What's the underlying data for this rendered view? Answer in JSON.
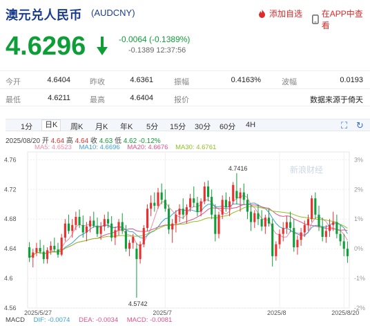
{
  "header": {
    "title": "澳元兑人民币",
    "code": "(AUDCNY)",
    "add_label": "添加自选",
    "app_label": "在APP中查看"
  },
  "quote": {
    "price": "4.6296",
    "change": "-0.0064",
    "change_pct": "(-0.1389%)",
    "sub_change": "-0.1389",
    "time": "12:37:56"
  },
  "stats": {
    "row1": [
      {
        "label": "今开",
        "value": "4.6404"
      },
      {
        "label": "昨收",
        "value": "4.6361"
      },
      {
        "label": "振幅",
        "value": "0.4163%"
      },
      {
        "label": "波幅",
        "value": "0.0193"
      }
    ],
    "row2": [
      {
        "label": "最低",
        "value": "4.6211"
      },
      {
        "label": "最高",
        "value": "4.6404"
      },
      {
        "label": "报价",
        "value": "数据来源于倚天"
      }
    ]
  },
  "tabs": [
    "1分",
    "日K",
    "周K",
    "月K",
    "年K",
    "5分",
    "15分",
    "30分",
    "60分",
    "4H"
  ],
  "active_tab": "日K",
  "info_line": {
    "date": "2025/08/20",
    "open_label": "开",
    "open": "4.64",
    "high_label": "高",
    "high": "4.64",
    "close_label": "收",
    "close": "4.63",
    "low_label": "低",
    "low": "4.62",
    "pct": "-0.12%"
  },
  "ma": [
    {
      "label": "MA5: 4.6523",
      "color": "#f08aa8"
    },
    {
      "label": "MA10: 4.6696",
      "color": "#3aa0d8"
    },
    {
      "label": "MA20: 4.6676",
      "color": "#e0508a"
    },
    {
      "label": "MA30: 4.6761",
      "color": "#8cc21e"
    }
  ],
  "macd": [
    {
      "label": "MACD",
      "color": "#444"
    },
    {
      "label": "DIF: -0.0074",
      "color": "#3aa0d8"
    },
    {
      "label": "DEA: -0.0034",
      "color": "#e0508a"
    },
    {
      "label": "MACD: -0.0081",
      "color": "#e0508a"
    }
  ],
  "colors": {
    "up": "#e8312f",
    "down": "#0e9e38",
    "brand": "#1a3c8e"
  },
  "chart_data": {
    "type": "candlestick",
    "y_ticks": [
      "4.76",
      "4.72",
      "4.68",
      "4.64",
      "4.6",
      "4.56"
    ],
    "y_ticks_right": [
      "3%",
      "2%",
      "1%",
      "0%",
      "-1%",
      "-2%"
    ],
    "x_labels": [
      "2025/5/27",
      "2025/7",
      "2025/8",
      "2025/8/20"
    ],
    "ylim": [
      4.56,
      4.765
    ],
    "annotations": [
      {
        "text": "4.7416",
        "x_index": 58,
        "value": 4.7416
      },
      {
        "text": "4.5742",
        "x_index": 30,
        "value": 4.5742
      }
    ],
    "watermark": "新浪财经",
    "candles": [
      [
        4.642,
        4.649,
        4.622,
        4.628
      ],
      [
        4.628,
        4.64,
        4.615,
        4.635
      ],
      [
        4.635,
        4.648,
        4.63,
        4.641
      ],
      [
        4.641,
        4.652,
        4.633,
        4.636
      ],
      [
        4.636,
        4.645,
        4.62,
        4.626
      ],
      [
        4.626,
        4.642,
        4.62,
        4.638
      ],
      [
        4.638,
        4.65,
        4.632,
        4.644
      ],
      [
        4.644,
        4.655,
        4.636,
        4.639
      ],
      [
        4.639,
        4.648,
        4.628,
        4.632
      ],
      [
        4.632,
        4.66,
        4.63,
        4.655
      ],
      [
        4.655,
        4.68,
        4.65,
        4.674
      ],
      [
        4.674,
        4.686,
        4.66,
        4.664
      ],
      [
        4.664,
        4.68,
        4.655,
        4.672
      ],
      [
        4.672,
        4.69,
        4.665,
        4.683
      ],
      [
        4.683,
        4.693,
        4.668,
        4.672
      ],
      [
        4.672,
        4.685,
        4.655,
        4.662
      ],
      [
        4.662,
        4.676,
        4.65,
        4.67
      ],
      [
        4.67,
        4.684,
        4.662,
        4.678
      ],
      [
        4.678,
        4.69,
        4.668,
        4.671
      ],
      [
        4.671,
        4.682,
        4.656,
        4.66
      ],
      [
        4.66,
        4.676,
        4.652,
        4.67
      ],
      [
        4.67,
        4.686,
        4.664,
        4.68
      ],
      [
        4.68,
        4.69,
        4.668,
        4.674
      ],
      [
        4.674,
        4.684,
        4.65,
        4.655
      ],
      [
        4.655,
        4.67,
        4.645,
        4.665
      ],
      [
        4.665,
        4.68,
        4.658,
        4.676
      ],
      [
        4.676,
        4.688,
        4.66,
        4.664
      ],
      [
        4.664,
        4.672,
        4.636,
        4.64
      ],
      [
        4.64,
        4.652,
        4.63,
        4.648
      ],
      [
        4.648,
        4.66,
        4.64,
        4.656
      ],
      [
        4.64,
        4.648,
        4.574,
        4.626
      ],
      [
        4.626,
        4.65,
        4.62,
        4.646
      ],
      [
        4.646,
        4.672,
        4.642,
        4.668
      ],
      [
        4.668,
        4.7,
        4.664,
        4.694
      ],
      [
        4.694,
        4.712,
        4.684,
        4.702
      ],
      [
        4.702,
        4.716,
        4.69,
        4.698
      ],
      [
        4.698,
        4.722,
        4.694,
        4.716
      ],
      [
        4.716,
        4.728,
        4.7,
        4.706
      ],
      [
        4.706,
        4.72,
        4.69,
        4.694
      ],
      [
        4.694,
        4.7,
        4.66,
        4.666
      ],
      [
        4.666,
        4.68,
        4.648,
        4.674
      ],
      [
        4.674,
        4.692,
        4.662,
        4.686
      ],
      [
        4.686,
        4.7,
        4.676,
        4.694
      ],
      [
        4.694,
        4.708,
        4.68,
        4.686
      ],
      [
        4.686,
        4.7,
        4.674,
        4.696
      ],
      [
        4.696,
        4.714,
        4.69,
        4.708
      ],
      [
        4.708,
        4.724,
        4.696,
        4.702
      ],
      [
        4.702,
        4.71,
        4.684,
        4.69
      ],
      [
        4.69,
        4.708,
        4.684,
        4.704
      ],
      [
        4.704,
        4.73,
        4.7,
        4.724
      ],
      [
        4.724,
        4.732,
        4.704,
        4.71
      ],
      [
        4.71,
        4.72,
        4.68,
        4.686
      ],
      [
        4.686,
        4.7,
        4.65,
        4.66
      ],
      [
        4.66,
        4.69,
        4.654,
        4.686
      ],
      [
        4.686,
        4.712,
        4.68,
        4.706
      ],
      [
        4.706,
        4.716,
        4.69,
        4.696
      ],
      [
        4.696,
        4.71,
        4.684,
        4.704
      ],
      [
        4.704,
        4.73,
        4.7,
        4.726
      ],
      [
        4.718,
        4.742,
        4.7,
        4.708
      ],
      [
        4.708,
        4.722,
        4.69,
        4.716
      ],
      [
        4.716,
        4.728,
        4.7,
        4.706
      ],
      [
        4.706,
        4.714,
        4.68,
        4.69
      ],
      [
        4.69,
        4.7,
        4.664,
        4.676
      ],
      [
        4.676,
        4.692,
        4.668,
        4.688
      ],
      [
        4.688,
        4.7,
        4.672,
        4.68
      ],
      [
        4.68,
        4.692,
        4.664,
        4.67
      ],
      [
        4.67,
        4.686,
        4.66,
        4.682
      ],
      [
        4.682,
        4.694,
        4.67,
        4.674
      ],
      [
        4.674,
        4.68,
        4.616,
        4.63
      ],
      [
        4.63,
        4.65,
        4.624,
        4.646
      ],
      [
        4.646,
        4.666,
        4.64,
        4.66
      ],
      [
        4.66,
        4.676,
        4.65,
        4.668
      ],
      [
        4.668,
        4.684,
        4.66,
        4.676
      ],
      [
        4.676,
        4.69,
        4.662,
        4.668
      ],
      [
        4.668,
        4.68,
        4.636,
        4.642
      ],
      [
        4.642,
        4.658,
        4.632,
        4.652
      ],
      [
        4.652,
        4.668,
        4.644,
        4.662
      ],
      [
        4.662,
        4.678,
        4.656,
        4.672
      ],
      [
        4.672,
        4.686,
        4.664,
        4.68
      ],
      [
        4.68,
        4.712,
        4.676,
        4.708
      ],
      [
        4.708,
        4.716,
        4.68,
        4.686
      ],
      [
        4.686,
        4.698,
        4.664,
        4.67
      ],
      [
        4.67,
        4.682,
        4.65,
        4.656
      ],
      [
        4.656,
        4.672,
        4.648,
        4.664
      ],
      [
        4.664,
        4.68,
        4.656,
        4.672
      ],
      [
        4.672,
        4.69,
        4.664,
        4.676
      ],
      [
        4.676,
        4.686,
        4.654,
        4.66
      ],
      [
        4.66,
        4.672,
        4.644,
        4.65
      ],
      [
        4.65,
        4.66,
        4.63,
        4.64
      ],
      [
        4.64,
        4.65,
        4.621,
        4.63
      ]
    ]
  }
}
